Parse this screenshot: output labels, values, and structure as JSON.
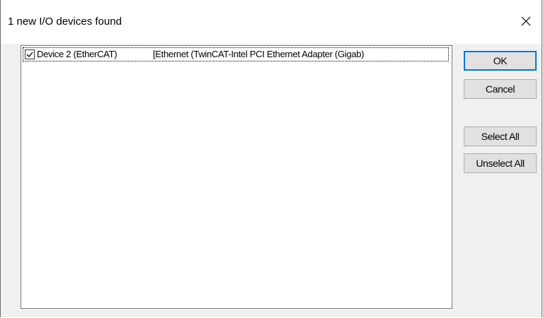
{
  "dialog": {
    "title": "1 new I/O devices found"
  },
  "devices": [
    {
      "checked": true,
      "name": "Device 2 (EtherCAT)",
      "adapter": "[Ethernet (TwinCAT-Intel PCI Ethernet Adapter (Gigab)"
    }
  ],
  "buttons": {
    "ok": "OK",
    "cancel": "Cancel",
    "select_all": "Select All",
    "unselect_all": "Unselect All"
  },
  "icons": {
    "close": "close-icon",
    "checkbox": "checkmark-icon"
  },
  "colors": {
    "default_button_border": "#0078d7",
    "button_face": "#e1e1e1",
    "dialog_bg": "#f0f0f0"
  }
}
